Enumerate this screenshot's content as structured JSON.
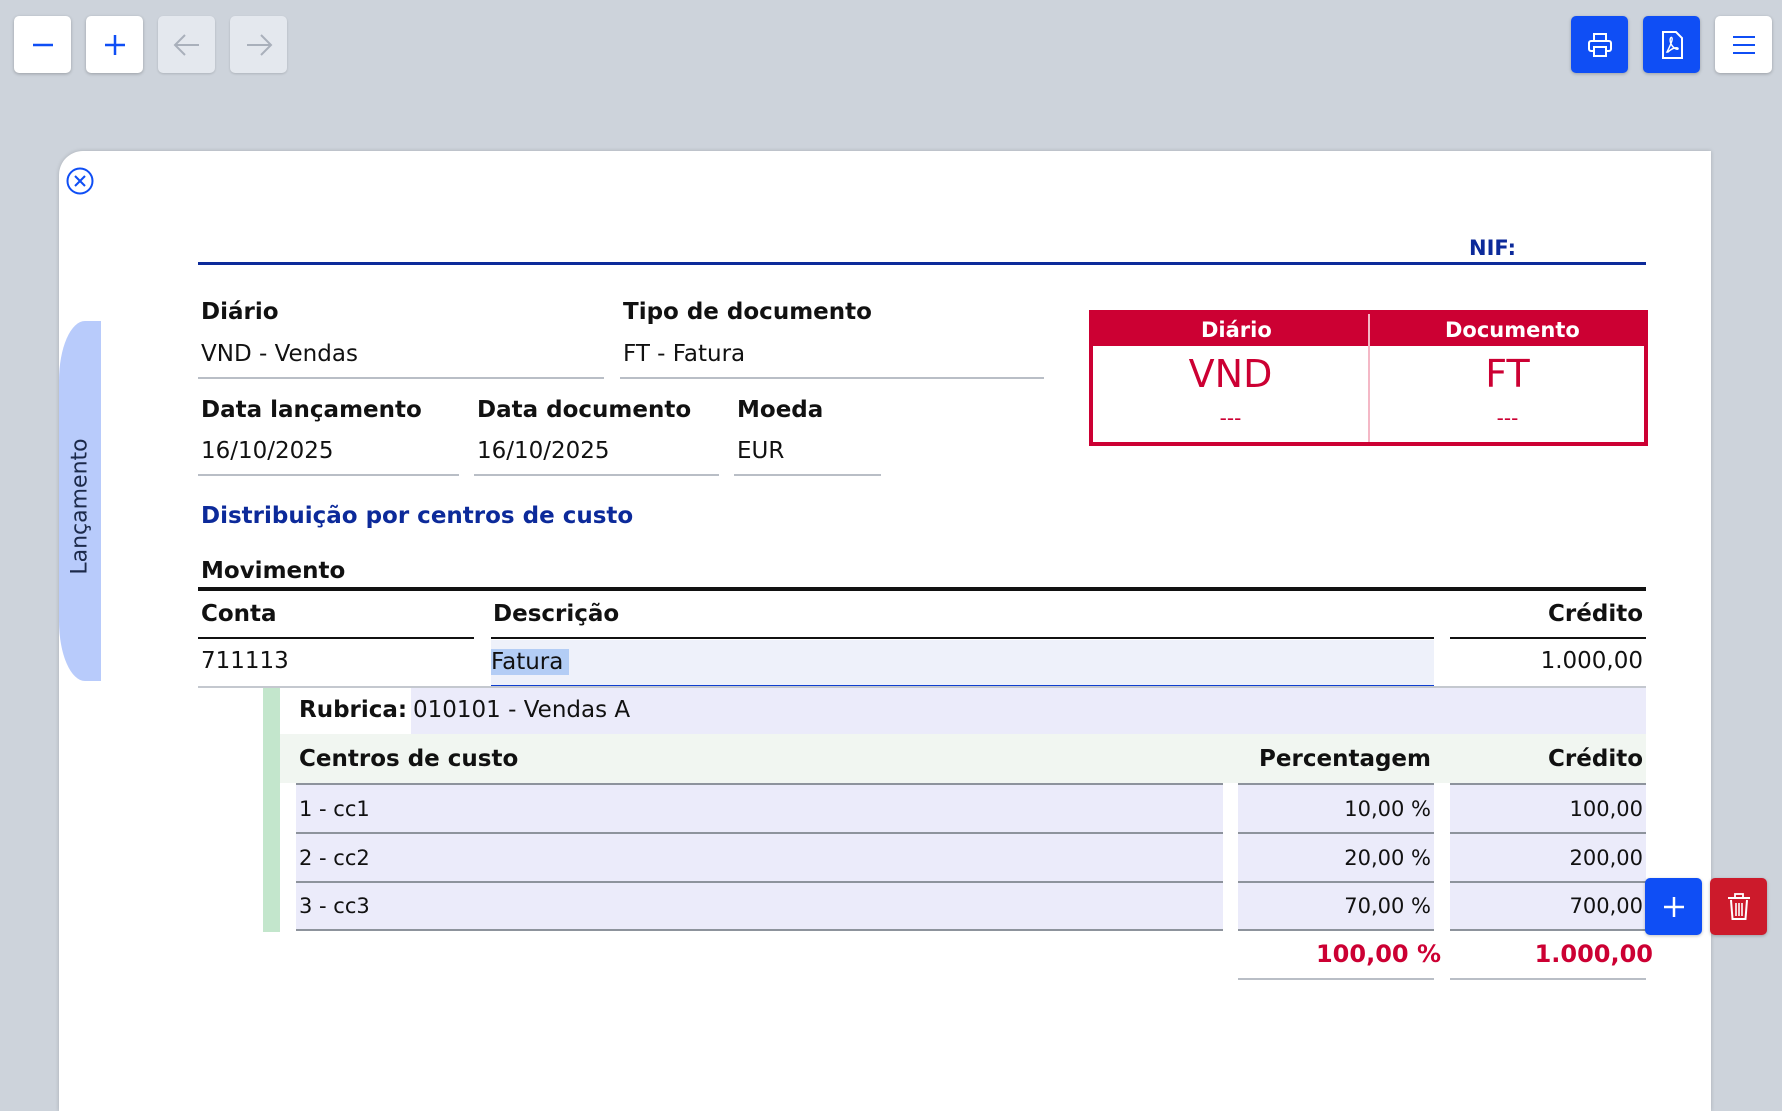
{
  "toolbar": {
    "zoom_out_icon": "minus-icon",
    "zoom_in_icon": "plus-icon",
    "back_icon": "arrow-left-icon",
    "forward_icon": "arrow-right-icon",
    "print_icon": "printer-icon",
    "pdf_icon": "pdf-icon",
    "menu_icon": "hamburger-menu-icon"
  },
  "side_tab": {
    "label": "Lançamento"
  },
  "header": {
    "nif_label": "NIF:"
  },
  "form": {
    "diario_label": "Diário",
    "diario_value": "VND - Vendas",
    "tipo_label": "Tipo de documento",
    "tipo_value": "FT - Fatura",
    "data_lanc_label": "Data lançamento",
    "data_lanc_value": "16/10/2025",
    "data_doc_label": "Data documento",
    "data_doc_value": "16/10/2025",
    "moeda_label": "Moeda",
    "moeda_value": "EUR"
  },
  "stamp": {
    "col1_header": "Diário",
    "col2_header": "Documento",
    "col1_code": "VND",
    "col2_code": "FT",
    "col1_number": "---",
    "col2_number": "---"
  },
  "section_title": "Distribuição por centros de custo",
  "movement": {
    "title": "Movimento",
    "col_conta": "Conta",
    "col_descricao": "Descrição",
    "col_credito": "Crédito",
    "conta": "711113",
    "descricao": "Fatura",
    "credito": "1.000,00"
  },
  "rubrica": {
    "label": "Rubrica:",
    "value": "010101 - Vendas A"
  },
  "cost_centers": {
    "col_centro": "Centros de custo",
    "col_percent": "Percentagem",
    "col_credito": "Crédito",
    "rows": [
      {
        "centro": "1 - cc1",
        "percent": "10,00 %",
        "credito": "100,00"
      },
      {
        "centro": "2 - cc2",
        "percent": "20,00 %",
        "credito": "200,00"
      },
      {
        "centro": "3 - cc3",
        "percent": "70,00 %",
        "credito": "700,00"
      }
    ],
    "total_percent": "100,00 %",
    "total_credito": "1.000,00"
  },
  "colors": {
    "accent_blue": "#0f4ef5",
    "stamp_red": "#cc0033",
    "title_blue": "#0c2a9a"
  }
}
